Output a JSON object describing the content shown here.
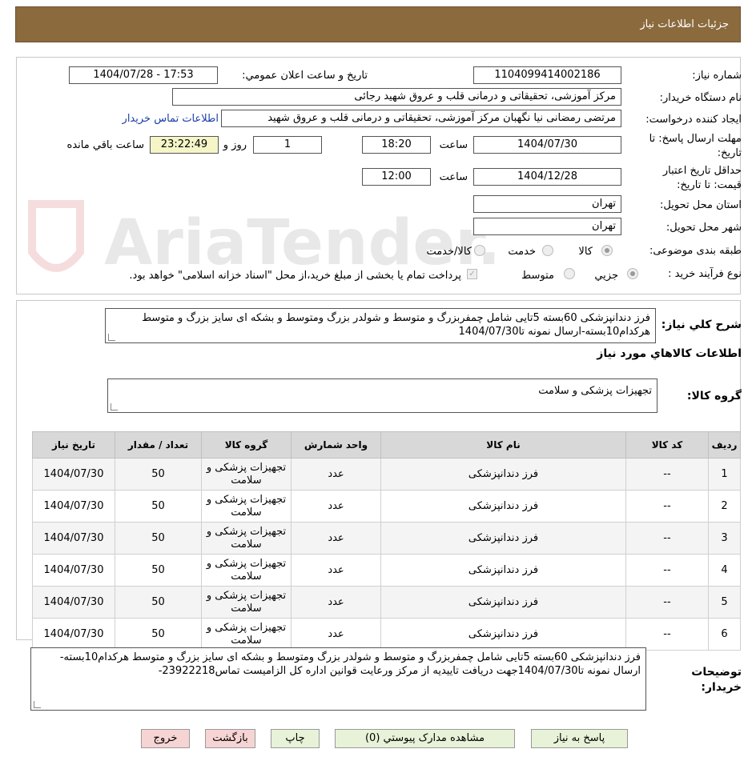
{
  "header": {
    "title": "جزئیات اطلاعات نیاز"
  },
  "details": {
    "need_number_label": "شماره نیاز:",
    "need_number": "1104099414002186",
    "announce_label": "تاریخ و ساعت اعلان عمومي:",
    "announce_value": "1404/07/28 - 17:53",
    "buyer_org_label": "نام دستگاه خريدار:",
    "buyer_org": "مرکز آموزشی، تحقیقاتی و درمانی قلب و عروق شهید رجائی",
    "requester_label": "ايجاد کننده درخواست:",
    "requester": "مرتضی رمضانی نیا نگهبان مرکز آموزشی، تحقیقاتی و درمانی قلب و عروق شهید",
    "contact_link": "اطلاعات تماس خريدار",
    "deadline_label_1": "مهلت ارسال پاسخ: تا",
    "deadline_label_2": "تاريخ:",
    "deadline_date": "1404/07/30",
    "time_label": "ساعت",
    "deadline_time": "18:20",
    "days_value": "1",
    "days_label": "روز و",
    "remaining_time": "23:22:49",
    "remaining_label": "ساعت باقي مانده",
    "price_valid_label_1": "حداقل تاريخ اعتبار",
    "price_valid_label_2": "قيمت: تا تاريخ:",
    "price_valid_date": "1404/12/28",
    "price_valid_time": "12:00",
    "province_label": "استان محل تحويل:",
    "province": "تهران",
    "city_label": "شهر محل تحويل:",
    "city": "تهران",
    "category_label": "طبقه بندی موضوعی:",
    "category_options": [
      "کالا",
      "خدمت",
      "کالا/خدمت"
    ],
    "purchase_type_label": "نوع فرآیند خرید :",
    "purchase_type_options": [
      "جزیي",
      "متوسط"
    ],
    "payment_note": "پرداخت تمام یا بخشی از مبلغ خرید،از محل \"اسناد خزانه اسلامی\" خواهد بود."
  },
  "summary": {
    "label": "شرح کلي نياز:",
    "text": "فرز دندانپزشکی 60بسته 5تایی شامل چمفربزرگ و متوسط و شولدر بزرگ ومتوسط و بشکه ای سایز بزرگ و متوسط  هرکدام10بسته-ارسال نمونه تا1404/07/30",
    "items_heading": "اطلاعات کالاهاي مورد نياز",
    "group_label": "گروه کالا:",
    "group_value": "تجهیزات پزشکی و سلامت"
  },
  "table": {
    "headers": [
      "رديف",
      "کد کالا",
      "نام کالا",
      "واحد شمارش",
      "گروه کالا",
      "تعداد / مقدار",
      "تاريخ نياز"
    ],
    "rows": [
      [
        "1",
        "--",
        "فرز دندانپزشکی",
        "عدد",
        "تجهیزات پزشکی و سلامت",
        "50",
        "1404/07/30"
      ],
      [
        "2",
        "--",
        "فرز دندانپزشکی",
        "عدد",
        "تجهیزات پزشکی و سلامت",
        "50",
        "1404/07/30"
      ],
      [
        "3",
        "--",
        "فرز دندانپزشکی",
        "عدد",
        "تجهیزات پزشکی و سلامت",
        "50",
        "1404/07/30"
      ],
      [
        "4",
        "--",
        "فرز دندانپزشکی",
        "عدد",
        "تجهیزات پزشکی و سلامت",
        "50",
        "1404/07/30"
      ],
      [
        "5",
        "--",
        "فرز دندانپزشکی",
        "عدد",
        "تجهیزات پزشکی و سلامت",
        "50",
        "1404/07/30"
      ],
      [
        "6",
        "--",
        "فرز دندانپزشکی",
        "عدد",
        "تجهیزات پزشکی و سلامت",
        "50",
        "1404/07/30"
      ]
    ]
  },
  "buyer_notes": {
    "label_1": "توضيحات",
    "label_2": "خريدار:",
    "text": "فرز دندانپزشکی 60بسته 5تایی شامل چمفربزرگ و متوسط و شولدر بزرگ ومتوسط و بشکه ای سایز بزرگ و متوسط هرکدام10بسته-ارسال نمونه تا1404/07/30جهت دریافت تاییدیه از مرکز ورعایت قوانین اداره کل الزامیست تماس23922218-"
  },
  "buttons": {
    "reply": "پاسخ به نياز",
    "attachments": "مشاهده مدارک پيوستي (0)",
    "print": "چاپ",
    "back": "بازگشت",
    "exit": "خروج"
  },
  "watermark": {
    "text": "AriaTender.neT"
  }
}
